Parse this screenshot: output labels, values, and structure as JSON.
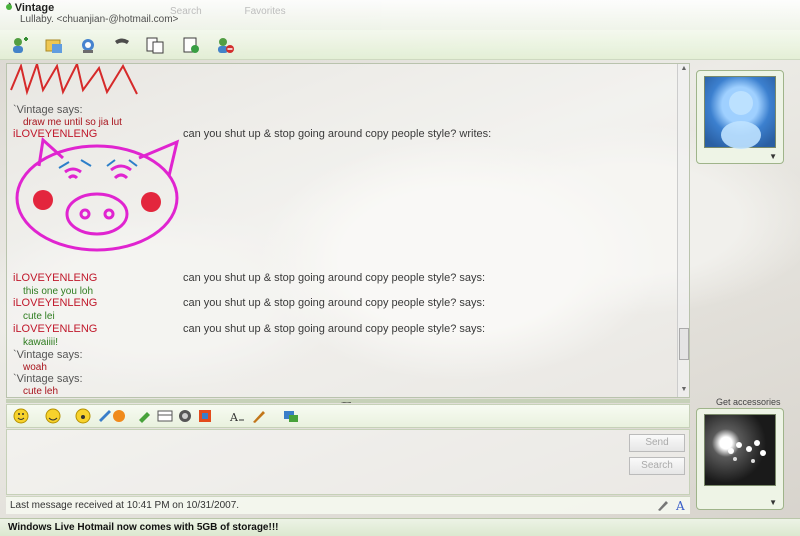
{
  "window": {
    "contact_name": "` Vintage",
    "contact_sub": "Lullaby.  <chuanjian-@hotmail.com>",
    "ghost_items": [
      "Search",
      "Favorites"
    ]
  },
  "toolbar": {
    "icons": [
      "invite-contact",
      "send-files",
      "video-call",
      "voice-call",
      "share-folder",
      "games",
      "block"
    ]
  },
  "conversation": [
    {
      "type": "says",
      "nick": "`Vintage says:",
      "text": "draw me until so jia lut",
      "text_color": "#a8141d"
    },
    {
      "type": "writes",
      "nick": "iLOVEYENLENG",
      "psm": "can you shut up & stop going around copy people style? writes:"
    },
    {
      "type": "says",
      "nick": "iLOVEYENLENG",
      "psm": "can you shut up & stop going around copy people style? says:",
      "text": "this one you loh",
      "text_color": "#2f7d20"
    },
    {
      "type": "says",
      "nick": "iLOVEYENLENG",
      "psm": "can you shut up & stop going around copy people style? says:",
      "text": "cute lei",
      "text_color": "#2f7d20"
    },
    {
      "type": "says",
      "nick": "iLOVEYENLENG",
      "psm": "can you shut up & stop going around copy people style? says:",
      "text": "kawaiiii!",
      "text_color": "#2f7d20"
    },
    {
      "type": "says",
      "nick": "`Vintage says:",
      "text": "woah",
      "text_color": "#a8141d"
    },
    {
      "type": "says",
      "nick": "`Vintage says:",
      "text": "cute leh",
      "text_color": "#a8141d"
    }
  ],
  "compose": {
    "send_label": "Send",
    "search_label": "Search",
    "dots": "........"
  },
  "status": {
    "last_message": "Last message received at 10:41 PM on 10/31/2007."
  },
  "sidebar": {
    "accessories_label": "Get accessories"
  },
  "bottom": {
    "hotmail_text": "Windows Live Hotmail now comes with 5GB of storage!!!"
  },
  "colors": {
    "accent_green": "#e4f0d6",
    "nick_red": "#c0182b",
    "drawing_magenta": "#e024d0"
  }
}
